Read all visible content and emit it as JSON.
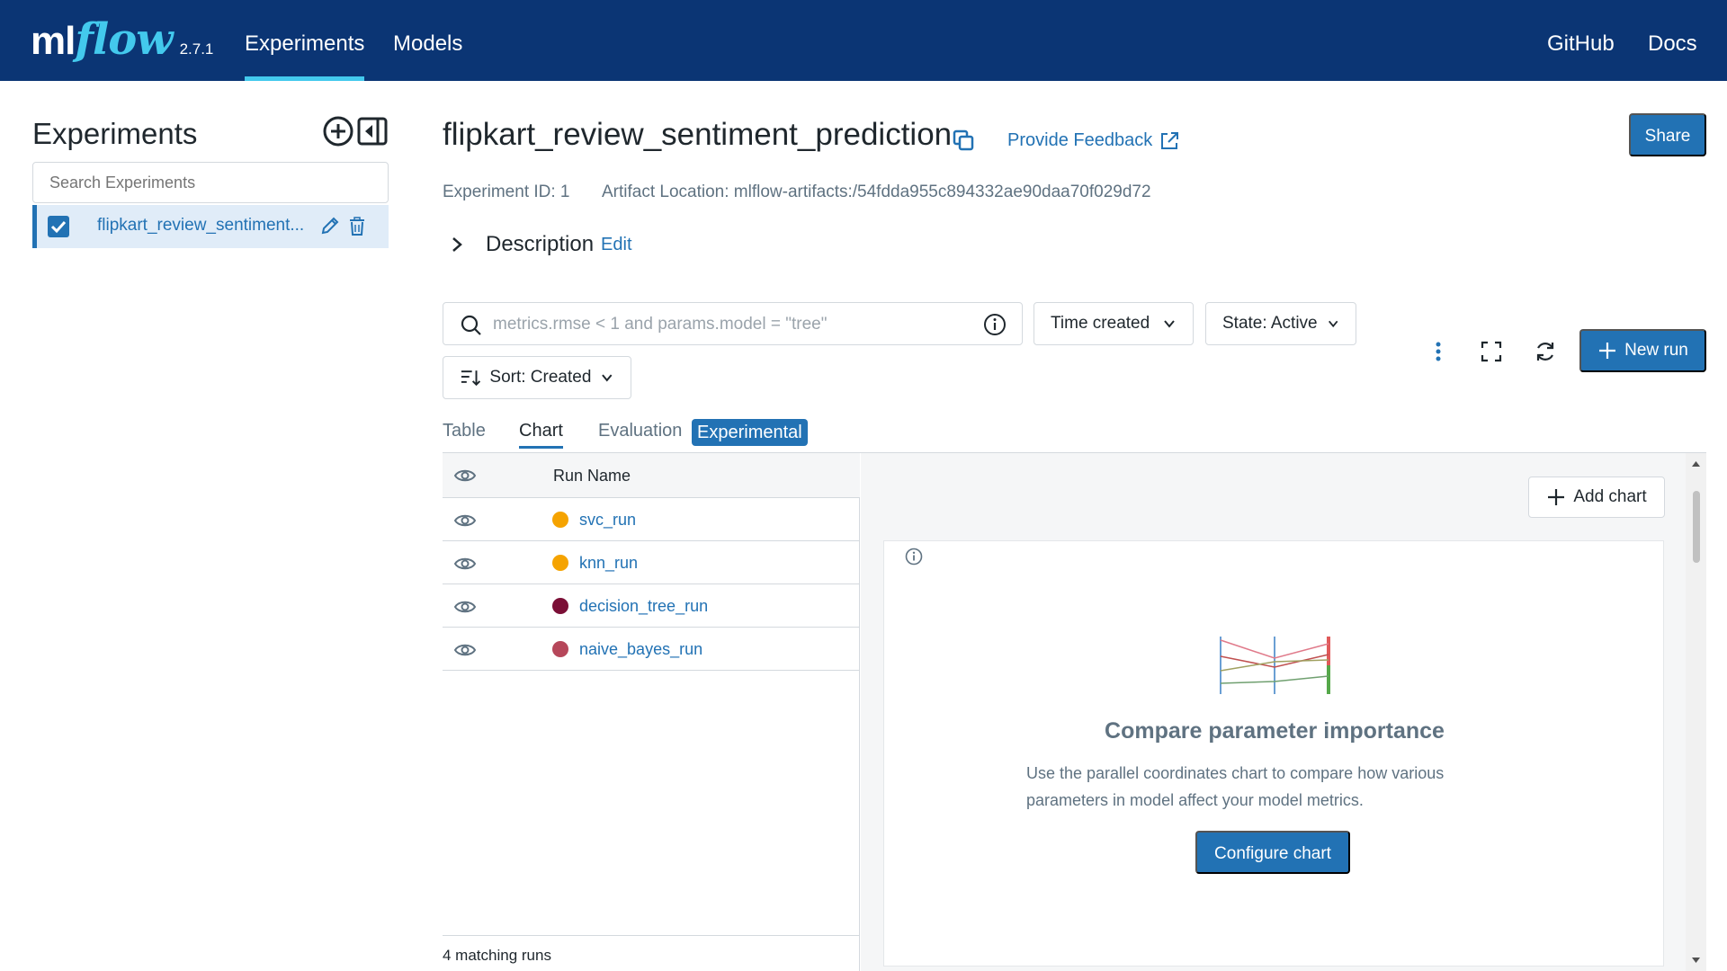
{
  "nav": {
    "logo_ml": "ml",
    "logo_flow": "flow",
    "version": "2.7.1",
    "experiments": "Experiments",
    "models": "Models",
    "github": "GitHub",
    "docs": "Docs"
  },
  "sidebar": {
    "title": "Experiments",
    "search_placeholder": "Search Experiments",
    "items": [
      {
        "label": "flipkart_review_sentiment..."
      }
    ]
  },
  "header": {
    "title": "flipkart_review_sentiment_prediction",
    "feedback": "Provide Feedback",
    "share": "Share",
    "experiment_id": "Experiment ID: 1",
    "artifact_location": "Artifact Location: mlflow-artifacts:/54fdda955c894332ae90daa70f029d72",
    "description": "Description",
    "edit": "Edit"
  },
  "filters": {
    "search_placeholder": "metrics.rmse < 1 and params.model = \"tree\"",
    "time_created": "Time created",
    "state": "State: Active",
    "sort": "Sort: Created",
    "new_run": "New run"
  },
  "tabs": {
    "table": "Table",
    "chart": "Chart",
    "evaluation": "Evaluation",
    "experimental": "Experimental"
  },
  "runs": {
    "header": "Run Name",
    "rows": [
      {
        "name": "svc_run",
        "color": "#f5a300"
      },
      {
        "name": "knn_run",
        "color": "#f5a300"
      },
      {
        "name": "decision_tree_run",
        "color": "#7b0f36"
      },
      {
        "name": "naive_bayes_run",
        "color": "#b6475a"
      }
    ],
    "footer": "4 matching runs"
  },
  "chart_panel": {
    "add_chart": "Add chart",
    "empty_title": "Compare parameter importance",
    "empty_text": "Use the parallel coordinates chart to compare how various parameters in model affect your model metrics.",
    "configure": "Configure chart"
  },
  "colors": {
    "nav_bg": "#0b3574",
    "accent": "#2272b4",
    "logo_flow": "#43c9ed"
  }
}
